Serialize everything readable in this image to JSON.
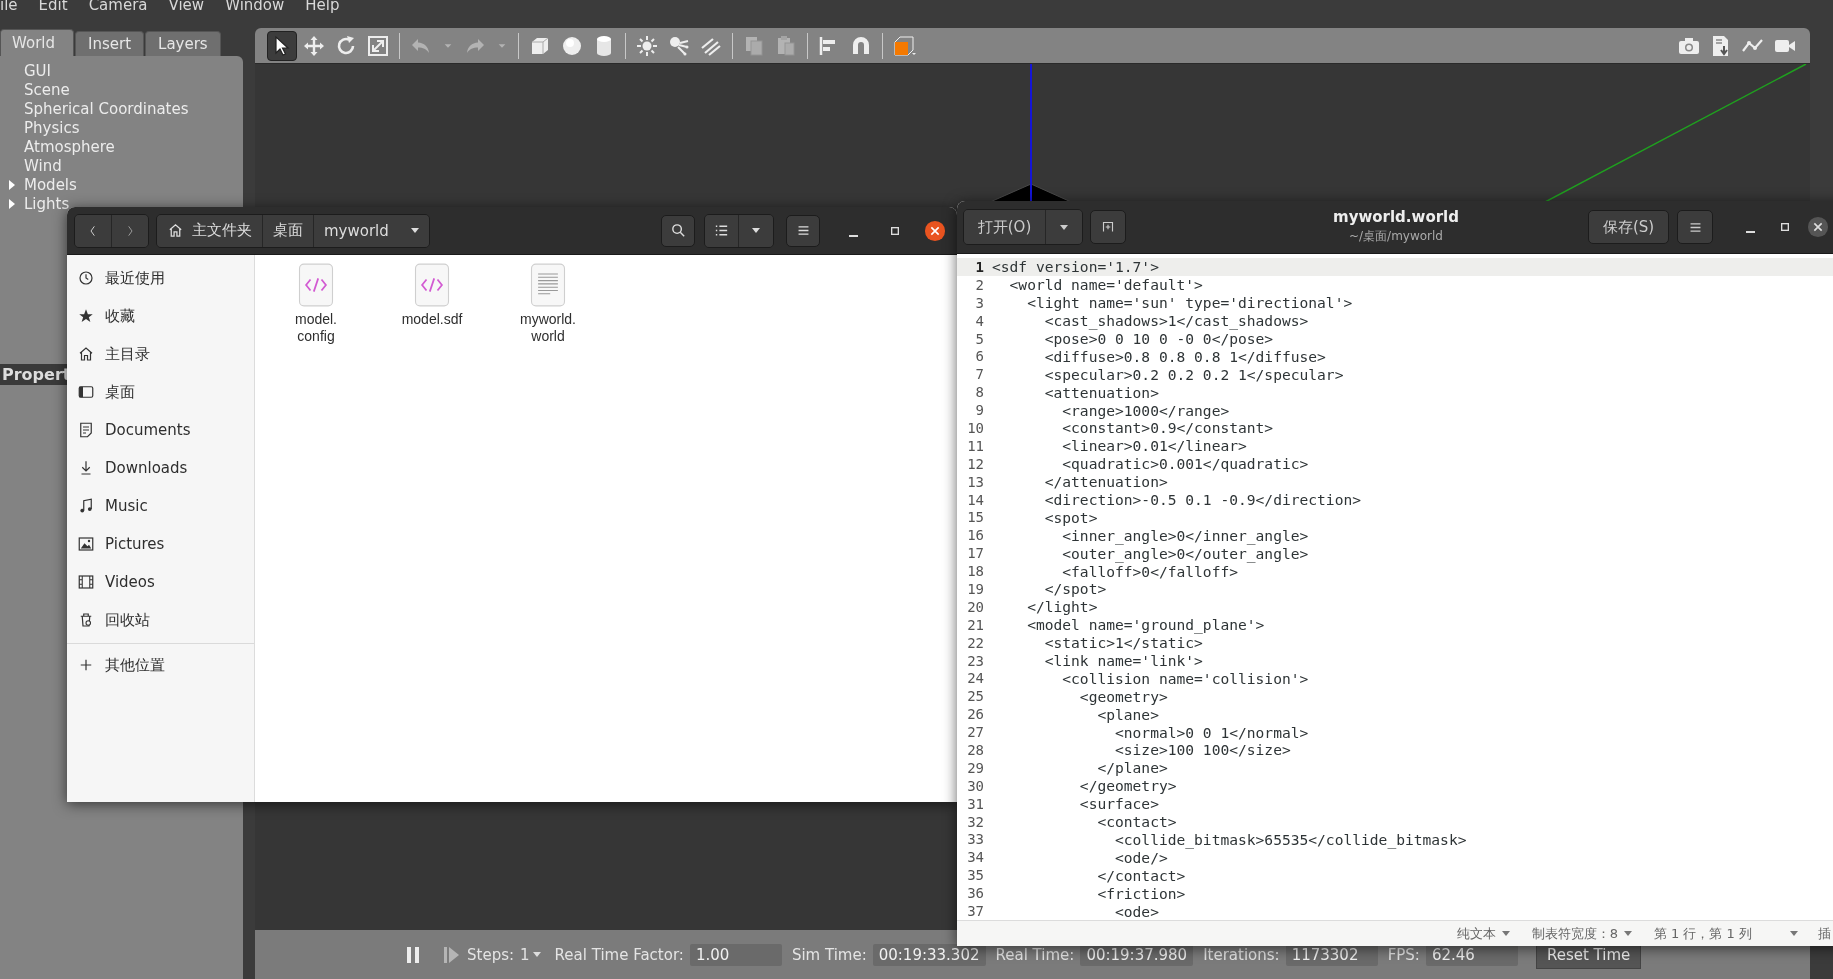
{
  "menu_bar": [
    "ile",
    "Edit",
    "Camera",
    "View",
    "Window",
    "Help"
  ],
  "left_panel": {
    "tabs": [
      {
        "label": "World",
        "selected": true
      },
      {
        "label": "Insert",
        "selected": false
      },
      {
        "label": "Layers",
        "selected": false
      }
    ],
    "tree": [
      {
        "label": "GUI"
      },
      {
        "label": "Scene"
      },
      {
        "label": "Spherical Coordinates"
      },
      {
        "label": "Physics"
      },
      {
        "label": "Atmosphere"
      },
      {
        "label": "Wind"
      },
      {
        "label": "Models",
        "expanded": false
      },
      {
        "label": "Lights",
        "expanded": false
      }
    ],
    "properties_label": "Propert"
  },
  "toolbar": {
    "groups": [
      [
        {
          "kind": "select",
          "selected": true,
          "disabled": false
        },
        {
          "kind": "translate",
          "selected": false,
          "disabled": false
        },
        {
          "kind": "rotate",
          "selected": false,
          "disabled": false
        },
        {
          "kind": "scale",
          "selected": false,
          "disabled": false
        }
      ],
      [
        {
          "kind": "undo",
          "selected": false,
          "disabled": true
        },
        {
          "kind": "caret",
          "selected": false,
          "disabled": true
        },
        {
          "kind": "redo",
          "selected": false,
          "disabled": true
        },
        {
          "kind": "caret",
          "selected": false,
          "disabled": true
        }
      ],
      [
        {
          "kind": "box",
          "selected": false,
          "disabled": false
        },
        {
          "kind": "sphere",
          "selected": false,
          "disabled": false
        },
        {
          "kind": "cylinder",
          "selected": false,
          "disabled": false
        }
      ],
      [
        {
          "kind": "point_light",
          "selected": false,
          "disabled": false
        },
        {
          "kind": "spot_light",
          "selected": false,
          "disabled": false
        },
        {
          "kind": "directional_light",
          "selected": false,
          "disabled": false
        }
      ],
      [
        {
          "kind": "copy",
          "selected": false,
          "disabled": true
        },
        {
          "kind": "paste",
          "selected": false,
          "disabled": true
        }
      ],
      [
        {
          "kind": "align",
          "selected": false,
          "disabled": false
        },
        {
          "kind": "snap",
          "selected": false,
          "disabled": false
        }
      ],
      [
        {
          "kind": "view",
          "selected": false,
          "disabled": false
        }
      ]
    ],
    "right": [
      {
        "kind": "camera",
        "selected": false,
        "disabled": false
      },
      {
        "kind": "log",
        "selected": false,
        "disabled": false
      },
      {
        "kind": "plot",
        "selected": false,
        "disabled": false
      },
      {
        "kind": "video",
        "selected": false,
        "disabled": false
      }
    ]
  },
  "bottom_bar": {
    "steps_label": "Steps:",
    "steps_value": "1",
    "fields": [
      {
        "label": "Real Time Factor:",
        "value": "1.00"
      },
      {
        "label": "Sim Time:",
        "value": "00:19:33.302"
      },
      {
        "label": "Real Time:",
        "value": "00:19:37.980"
      },
      {
        "label": "Iterations:",
        "value": "1173302"
      },
      {
        "label": "FPS:",
        "value": "62.46"
      }
    ],
    "reset_button": "Reset Time"
  },
  "file_manager": {
    "path": [
      "主文件夹",
      "桌面",
      "myworld"
    ],
    "sidebar": [
      {
        "label": "最近使用",
        "kind": "recent"
      },
      {
        "label": "收藏",
        "kind": "starred"
      },
      {
        "label": "主目录",
        "kind": "home"
      },
      {
        "label": "桌面",
        "kind": "desktop"
      },
      {
        "label": "Documents",
        "kind": "documents"
      },
      {
        "label": "Downloads",
        "kind": "downloads"
      },
      {
        "label": "Music",
        "kind": "music"
      },
      {
        "label": "Pictures",
        "kind": "pictures"
      },
      {
        "label": "Videos",
        "kind": "videos"
      },
      {
        "label": "回收站",
        "kind": "trash"
      },
      {
        "label": "其他位置",
        "kind": "other"
      }
    ],
    "files": [
      {
        "name": "model.config",
        "kind": "code"
      },
      {
        "name": "model.sdf",
        "kind": "code"
      },
      {
        "name": "myworld.world",
        "kind": "text"
      }
    ]
  },
  "editor": {
    "open_button": "打开(O)",
    "title": "myworld.world",
    "subtitle": "~/桌面/myworld",
    "save_button": "保存(S)",
    "lines": [
      {
        "number": "1",
        "text": "<sdf version='1.7'>",
        "current": true
      },
      {
        "number": "2",
        "text": "  <world name='default'>",
        "current": false
      },
      {
        "number": "3",
        "text": "    <light name='sun' type='directional'>",
        "current": false
      },
      {
        "number": "4",
        "text": "      <cast_shadows>1</cast_shadows>",
        "current": false
      },
      {
        "number": "5",
        "text": "      <pose>0 0 10 0 -0 0</pose>",
        "current": false
      },
      {
        "number": "6",
        "text": "      <diffuse>0.8 0.8 0.8 1</diffuse>",
        "current": false
      },
      {
        "number": "7",
        "text": "      <specular>0.2 0.2 0.2 1</specular>",
        "current": false
      },
      {
        "number": "8",
        "text": "      <attenuation>",
        "current": false
      },
      {
        "number": "9",
        "text": "        <range>1000</range>",
        "current": false
      },
      {
        "number": "10",
        "text": "        <constant>0.9</constant>",
        "current": false
      },
      {
        "number": "11",
        "text": "        <linear>0.01</linear>",
        "current": false
      },
      {
        "number": "12",
        "text": "        <quadratic>0.001</quadratic>",
        "current": false
      },
      {
        "number": "13",
        "text": "      </attenuation>",
        "current": false
      },
      {
        "number": "14",
        "text": "      <direction>-0.5 0.1 -0.9</direction>",
        "current": false
      },
      {
        "number": "15",
        "text": "      <spot>",
        "current": false
      },
      {
        "number": "16",
        "text": "        <inner_angle>0</inner_angle>",
        "current": false
      },
      {
        "number": "17",
        "text": "        <outer_angle>0</outer_angle>",
        "current": false
      },
      {
        "number": "18",
        "text": "        <falloff>0</falloff>",
        "current": false
      },
      {
        "number": "19",
        "text": "      </spot>",
        "current": false
      },
      {
        "number": "20",
        "text": "    </light>",
        "current": false
      },
      {
        "number": "21",
        "text": "    <model name='ground_plane'>",
        "current": false
      },
      {
        "number": "22",
        "text": "      <static>1</static>",
        "current": false
      },
      {
        "number": "23",
        "text": "      <link name='link'>",
        "current": false
      },
      {
        "number": "24",
        "text": "        <collision name='collision'>",
        "current": false
      },
      {
        "number": "25",
        "text": "          <geometry>",
        "current": false
      },
      {
        "number": "26",
        "text": "            <plane>",
        "current": false
      },
      {
        "number": "27",
        "text": "              <normal>0 0 1</normal>",
        "current": false
      },
      {
        "number": "28",
        "text": "              <size>100 100</size>",
        "current": false
      },
      {
        "number": "29",
        "text": "            </plane>",
        "current": false
      },
      {
        "number": "30",
        "text": "          </geometry>",
        "current": false
      },
      {
        "number": "31",
        "text": "          <surface>",
        "current": false
      },
      {
        "number": "32",
        "text": "            <contact>",
        "current": false
      },
      {
        "number": "33",
        "text": "              <collide_bitmask>65535</collide_bitmask>",
        "current": false
      },
      {
        "number": "34",
        "text": "              <ode/>",
        "current": false
      },
      {
        "number": "35",
        "text": "            </contact>",
        "current": false
      },
      {
        "number": "36",
        "text": "            <friction>",
        "current": false
      },
      {
        "number": "37",
        "text": "              <ode>",
        "current": false
      }
    ],
    "status": {
      "language": "纯文本",
      "tab_width": "制表符宽度：8",
      "position": "第 1 行，第 1 列",
      "mode": "插"
    }
  }
}
